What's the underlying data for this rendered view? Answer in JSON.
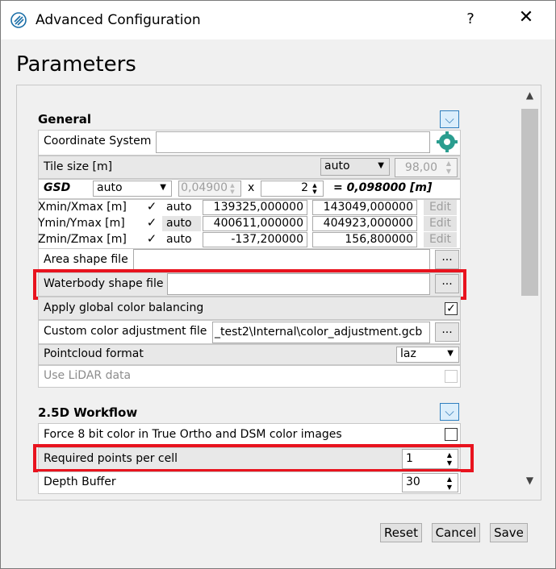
{
  "window": {
    "title": "Advanced Configuration",
    "help_glyph": "?",
    "close_glyph": "✕",
    "page_title": "Parameters"
  },
  "general": {
    "title": "General",
    "coordinate_system": {
      "label": "Coordinate System",
      "value": ""
    },
    "tile_size": {
      "label": "Tile size [m]",
      "mode": "auto",
      "value": "98,00"
    },
    "gsd": {
      "label": "GSD",
      "mode": "auto",
      "value": "0,04900",
      "times": "x",
      "multiplier": "2",
      "result": "= 0,098000 [m]"
    },
    "extents": [
      {
        "label": "Xmin/Xmax [m]",
        "checked": true,
        "mode": "auto",
        "min": "139325,000000",
        "max": "143049,000000",
        "edit": "Edit"
      },
      {
        "label": "Ymin/Ymax [m]",
        "checked": true,
        "mode": "auto",
        "min": "400611,000000",
        "max": "404923,000000",
        "edit": "Edit"
      },
      {
        "label": "Zmin/Zmax [m]",
        "checked": true,
        "mode": "auto",
        "min": "-137,200000",
        "max": "156,800000",
        "edit": "Edit"
      }
    ],
    "area_shape_file": {
      "label": "Area shape file",
      "value": "",
      "browse": "..."
    },
    "waterbody_shape_file": {
      "label": "Waterbody shape file",
      "value": "",
      "browse": "..."
    },
    "global_color_balancing": {
      "label": "Apply global color balancing",
      "checked": true
    },
    "custom_color_adjustment": {
      "label": "Custom color adjustment file",
      "value": "_test2\\Internal\\color_adjustment.gcb",
      "browse": "..."
    },
    "pointcloud_format": {
      "label": "Pointcloud format",
      "value": "laz"
    },
    "use_lidar": {
      "label": "Use LiDAR data",
      "checked": false
    }
  },
  "workflow_25d": {
    "title": "2.5D Workflow",
    "force_8bit": {
      "label": "Force 8 bit color in True Ortho and DSM color images",
      "checked": false
    },
    "required_points": {
      "label": "Required points per cell",
      "value": "1"
    },
    "depth_buffer": {
      "label": "Depth Buffer",
      "value": "30"
    }
  },
  "buttons": {
    "reset": "Reset",
    "cancel": "Cancel",
    "save": "Save"
  },
  "colors": {
    "highlight": "#e8131e",
    "accent": "#2f7fbf"
  }
}
